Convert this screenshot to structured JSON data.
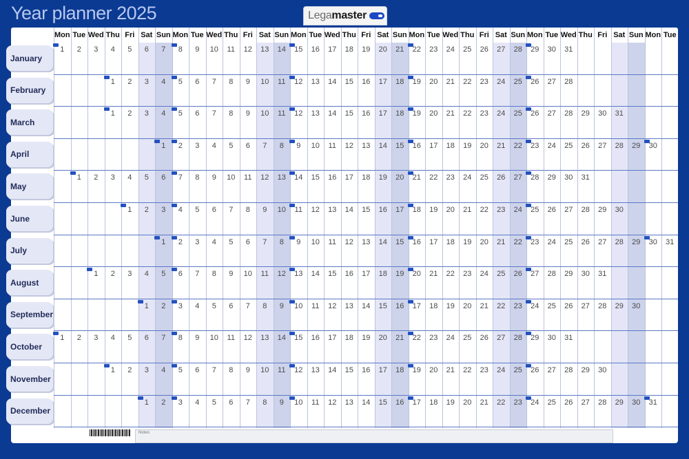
{
  "title": "Year planner 2025",
  "brand": {
    "name_light": "Lega",
    "name_bold": "master",
    "mark": "legamaster-logo-icon"
  },
  "colors": {
    "background": "#0b3a93",
    "saturday": "#e4e6f7",
    "sunday": "#cdd3eb",
    "tab": "#e4e7f5",
    "accent": "#2451c0"
  },
  "weekday_headers": [
    "Mon",
    "Tue",
    "Wed",
    "Thu",
    "Fri",
    "Sat",
    "Sun",
    "Mon",
    "Tue",
    "Wed",
    "Thu",
    "Fri",
    "Sat",
    "Sun",
    "Mon",
    "Tue",
    "Wed",
    "Thu",
    "Fri",
    "Sat",
    "Sun",
    "Mon",
    "Tue",
    "Wed",
    "Thu",
    "Fri",
    "Sat",
    "Sun",
    "Mon",
    "Tue",
    "Wed",
    "Thu",
    "Fri",
    "Sat",
    "Sun",
    "Mon",
    "Tue"
  ],
  "months": [
    {
      "name": "January",
      "start": 0,
      "days": 31
    },
    {
      "name": "February",
      "start": 3,
      "days": 28
    },
    {
      "name": "March",
      "start": 3,
      "days": 31
    },
    {
      "name": "April",
      "start": 6,
      "days": 30
    },
    {
      "name": "May",
      "start": 1,
      "days": 31
    },
    {
      "name": "June",
      "start": 4,
      "days": 30
    },
    {
      "name": "July",
      "start": 6,
      "days": 31
    },
    {
      "name": "August",
      "start": 2,
      "days": 31
    },
    {
      "name": "September",
      "start": 5,
      "days": 30
    },
    {
      "name": "October",
      "start": 0,
      "days": 31
    },
    {
      "name": "November",
      "start": 3,
      "days": 30
    },
    {
      "name": "December",
      "start": 5,
      "days": 31
    }
  ],
  "bottom": {
    "notes_label": "Notes:"
  }
}
